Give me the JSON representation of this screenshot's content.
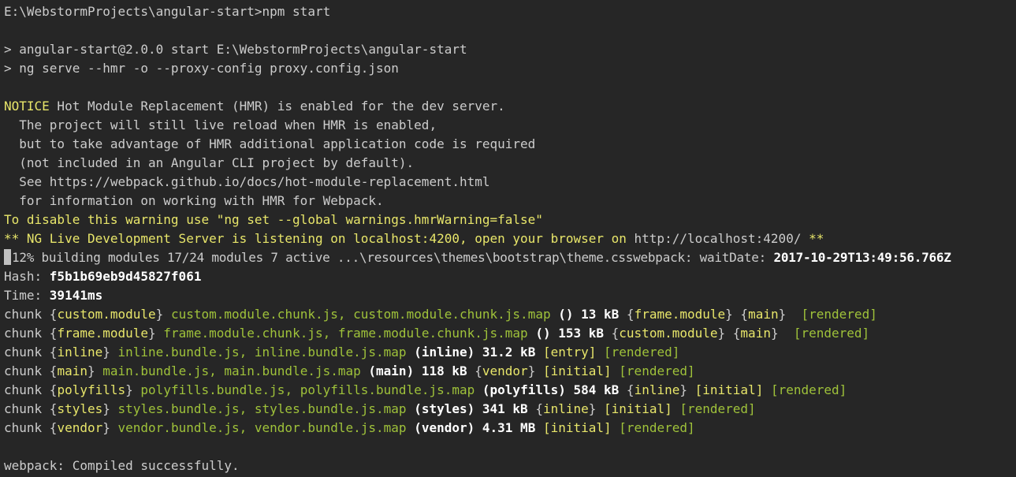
{
  "terminal": {
    "lines": [
      {
        "segments": [
          {
            "text": "E:\\WebstormProjects\\angular-start>npm start",
            "style": "gray"
          }
        ]
      },
      {
        "segments": [
          {
            "text": "",
            "style": "gray"
          }
        ]
      },
      {
        "segments": [
          {
            "text": "> angular-start@2.0.0 start E:\\WebstormProjects\\angular-start",
            "style": "gray"
          }
        ]
      },
      {
        "segments": [
          {
            "text": "> ng serve --hmr -o --proxy-config proxy.config.json",
            "style": "gray"
          }
        ]
      },
      {
        "segments": [
          {
            "text": "",
            "style": "gray"
          }
        ]
      },
      {
        "segments": [
          {
            "text": "NOTICE",
            "style": "yellow"
          },
          {
            "text": " Hot Module Replacement (HMR) is enabled for the dev server.",
            "style": "gray"
          }
        ]
      },
      {
        "segments": [
          {
            "text": "  The project will still live reload when HMR is enabled,",
            "style": "gray"
          }
        ]
      },
      {
        "segments": [
          {
            "text": "  but to take advantage of HMR additional application code is required",
            "style": "gray"
          }
        ]
      },
      {
        "segments": [
          {
            "text": "  (not included in an Angular CLI project by default).",
            "style": "gray"
          }
        ]
      },
      {
        "segments": [
          {
            "text": "  See https://webpack.github.io/docs/hot-module-replacement.html",
            "style": "gray"
          }
        ]
      },
      {
        "segments": [
          {
            "text": "  for information on working with HMR for Webpack.",
            "style": "gray"
          }
        ]
      },
      {
        "segments": [
          {
            "text": "To disable this warning use \"ng set --global warnings.hmrWarning=false\"",
            "style": "yellow"
          }
        ]
      },
      {
        "segments": [
          {
            "text": "** NG Live Development Server is listening on localhost:4200, open your browser on ",
            "style": "yellow"
          },
          {
            "text": "http://localhost:4200/",
            "style": "gray"
          },
          {
            "text": " **",
            "style": "yellow"
          }
        ]
      },
      {
        "cursor": true,
        "progress": true,
        "segments": [
          {
            "text": "12% building modules 17/24 modules 7 active ...\\resources\\themes\\bootstrap\\theme.csswebpack: waitDate: ",
            "style": "gray"
          },
          {
            "text": "2017-10-29T13:49:56.766Z",
            "style": "bold"
          }
        ]
      },
      {
        "segments": [
          {
            "text": "Hash: ",
            "style": "gray"
          },
          {
            "text": "f5b1b69eb9d45827f061",
            "style": "bold"
          }
        ]
      },
      {
        "segments": [
          {
            "text": "Time: ",
            "style": "gray"
          },
          {
            "text": "39141ms",
            "style": "bold"
          }
        ]
      },
      {
        "segments": [
          {
            "text": "chunk ",
            "style": "gray"
          },
          {
            "text": "{",
            "style": "gray"
          },
          {
            "text": "custom.module",
            "style": "yellow"
          },
          {
            "text": "}",
            "style": "gray"
          },
          {
            "text": " custom.module.chunk.js, custom.module.chunk.js.map",
            "style": "green"
          },
          {
            "text": " () ",
            "style": "bold"
          },
          {
            "text": "13 kB",
            "style": "bold"
          },
          {
            "text": " {",
            "style": "gray"
          },
          {
            "text": "frame.module",
            "style": "yellow"
          },
          {
            "text": "}",
            "style": "gray"
          },
          {
            "text": " {",
            "style": "gray"
          },
          {
            "text": "main",
            "style": "yellow"
          },
          {
            "text": "}",
            "style": "gray"
          },
          {
            "text": "  [rendered]",
            "style": "green"
          }
        ]
      },
      {
        "segments": [
          {
            "text": "chunk ",
            "style": "gray"
          },
          {
            "text": "{",
            "style": "gray"
          },
          {
            "text": "frame.module",
            "style": "yellow"
          },
          {
            "text": "}",
            "style": "gray"
          },
          {
            "text": " frame.module.chunk.js, frame.module.chunk.js.map",
            "style": "green"
          },
          {
            "text": " () ",
            "style": "bold"
          },
          {
            "text": "153 kB",
            "style": "bold"
          },
          {
            "text": " {",
            "style": "gray"
          },
          {
            "text": "custom.module",
            "style": "yellow"
          },
          {
            "text": "}",
            "style": "gray"
          },
          {
            "text": " {",
            "style": "gray"
          },
          {
            "text": "main",
            "style": "yellow"
          },
          {
            "text": "}",
            "style": "gray"
          },
          {
            "text": "  [rendered]",
            "style": "green"
          }
        ]
      },
      {
        "segments": [
          {
            "text": "chunk ",
            "style": "gray"
          },
          {
            "text": "{",
            "style": "gray"
          },
          {
            "text": "inline",
            "style": "yellow"
          },
          {
            "text": "}",
            "style": "gray"
          },
          {
            "text": " inline.bundle.js, inline.bundle.js.map",
            "style": "green"
          },
          {
            "text": " (inline) ",
            "style": "bold"
          },
          {
            "text": "31.2 kB",
            "style": "bold"
          },
          {
            "text": " [entry]",
            "style": "yellow"
          },
          {
            "text": " [rendered]",
            "style": "green"
          }
        ]
      },
      {
        "segments": [
          {
            "text": "chunk ",
            "style": "gray"
          },
          {
            "text": "{",
            "style": "gray"
          },
          {
            "text": "main",
            "style": "yellow"
          },
          {
            "text": "}",
            "style": "gray"
          },
          {
            "text": " main.bundle.js, main.bundle.js.map",
            "style": "green"
          },
          {
            "text": " (main) ",
            "style": "bold"
          },
          {
            "text": "118 kB",
            "style": "bold"
          },
          {
            "text": " {",
            "style": "gray"
          },
          {
            "text": "vendor",
            "style": "yellow"
          },
          {
            "text": "}",
            "style": "gray"
          },
          {
            "text": " [initial]",
            "style": "yellow"
          },
          {
            "text": " [rendered]",
            "style": "green"
          }
        ]
      },
      {
        "segments": [
          {
            "text": "chunk ",
            "style": "gray"
          },
          {
            "text": "{",
            "style": "gray"
          },
          {
            "text": "polyfills",
            "style": "yellow"
          },
          {
            "text": "}",
            "style": "gray"
          },
          {
            "text": " polyfills.bundle.js, polyfills.bundle.js.map",
            "style": "green"
          },
          {
            "text": " (polyfills) ",
            "style": "bold"
          },
          {
            "text": "584 kB",
            "style": "bold"
          },
          {
            "text": " {",
            "style": "gray"
          },
          {
            "text": "inline",
            "style": "yellow"
          },
          {
            "text": "}",
            "style": "gray"
          },
          {
            "text": " [initial]",
            "style": "yellow"
          },
          {
            "text": " [rendered]",
            "style": "green"
          }
        ]
      },
      {
        "segments": [
          {
            "text": "chunk ",
            "style": "gray"
          },
          {
            "text": "{",
            "style": "gray"
          },
          {
            "text": "styles",
            "style": "yellow"
          },
          {
            "text": "}",
            "style": "gray"
          },
          {
            "text": " styles.bundle.js, styles.bundle.js.map",
            "style": "green"
          },
          {
            "text": " (styles) ",
            "style": "bold"
          },
          {
            "text": "341 kB",
            "style": "bold"
          },
          {
            "text": " {",
            "style": "gray"
          },
          {
            "text": "inline",
            "style": "yellow"
          },
          {
            "text": "}",
            "style": "gray"
          },
          {
            "text": " [initial]",
            "style": "yellow"
          },
          {
            "text": " [rendered]",
            "style": "green"
          }
        ]
      },
      {
        "segments": [
          {
            "text": "chunk ",
            "style": "gray"
          },
          {
            "text": "{",
            "style": "gray"
          },
          {
            "text": "vendor",
            "style": "yellow"
          },
          {
            "text": "}",
            "style": "gray"
          },
          {
            "text": " vendor.bundle.js, vendor.bundle.js.map",
            "style": "green"
          },
          {
            "text": " (vendor) ",
            "style": "bold"
          },
          {
            "text": "4.31 MB",
            "style": "bold"
          },
          {
            "text": " [initial]",
            "style": "yellow"
          },
          {
            "text": " [rendered]",
            "style": "green"
          }
        ]
      },
      {
        "segments": [
          {
            "text": "",
            "style": "gray"
          }
        ]
      },
      {
        "segments": [
          {
            "text": "webpack: Compiled successfully.",
            "style": "gray"
          }
        ]
      }
    ],
    "colors": {
      "background": "#262626",
      "text": "#cccccc",
      "yellow": "#e8e66a",
      "green": "#9fc23a",
      "bold": "#ffffff"
    }
  }
}
